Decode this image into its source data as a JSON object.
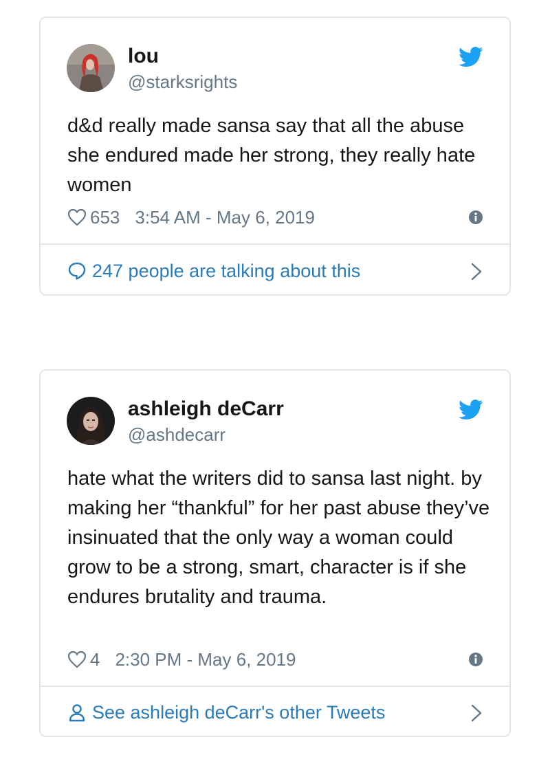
{
  "tweets": [
    {
      "name": "lou",
      "handle": "@starksrights",
      "text": "d&d really made sansa say that all the abuse she endured made her strong, they really hate women",
      "likes": "653",
      "time": "3:54 AM - May 6, 2019",
      "footer_label": "247 people are talking about this",
      "footer_icon": "speech-bubble-icon",
      "avatar_colors": {
        "hair": "#c8322a",
        "background": "#8a8580",
        "clothes": "#5b4d43"
      }
    },
    {
      "name": "ashleigh deCarr",
      "handle": "@ashdecarr",
      "text": "hate what the writers did to sansa last night. by making her “thankful” for her past abuse they’ve insinuated that the only way a woman could grow to be a strong, smart, character is if she endures brutality and trauma.",
      "likes": "4",
      "time": "2:30 PM - May 6, 2019",
      "footer_label": "See ashleigh deCarr's other Tweets",
      "footer_icon": "person-icon",
      "avatar_colors": {
        "hair": "#2a1e1a",
        "background": "#1c1c1f",
        "skin": "#d7b7a6"
      }
    }
  ],
  "colors": {
    "brand": "#1da1f2",
    "link": "#2b7bb9",
    "secondary_text": "#657786",
    "border": "#e1e8ed"
  }
}
